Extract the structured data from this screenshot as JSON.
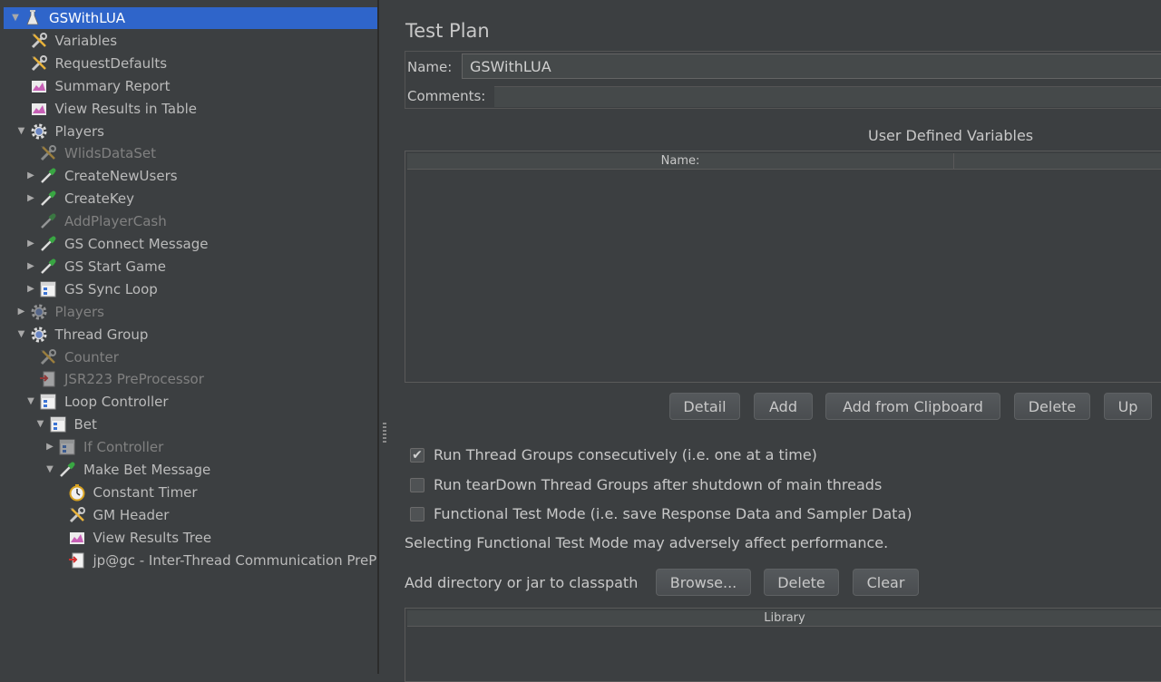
{
  "tree": {
    "items": [
      {
        "label": "GSWithLUA",
        "icon": "test-plan-icon",
        "arrow": "▼",
        "selected": true
      },
      {
        "label": "Variables",
        "icon": "wrench-icon"
      },
      {
        "label": "RequestDefaults",
        "icon": "wrench-icon"
      },
      {
        "label": "Summary Report",
        "icon": "report-icon"
      },
      {
        "label": "View Results in Table",
        "icon": "report-icon"
      },
      {
        "label": "Players",
        "icon": "gear-icon",
        "arrow": "▼"
      },
      {
        "label": "WlidsDataSet",
        "icon": "wrench-icon",
        "disabled": true
      },
      {
        "label": "CreateNewUsers",
        "icon": "pipette-icon",
        "arrow": "▶"
      },
      {
        "label": "CreateKey",
        "icon": "pipette-icon",
        "arrow": "▶"
      },
      {
        "label": "AddPlayerCash",
        "icon": "pipette-icon",
        "disabled": true
      },
      {
        "label": "GS Connect Message",
        "icon": "pipette-icon",
        "arrow": "▶"
      },
      {
        "label": "GS Start Game",
        "icon": "pipette-icon",
        "arrow": "▶"
      },
      {
        "label": "GS Sync Loop",
        "icon": "controller-icon",
        "arrow": "▶"
      },
      {
        "label": "Players",
        "icon": "gear-icon",
        "arrow": "▶",
        "disabled": true
      },
      {
        "label": "Thread Group",
        "icon": "gear-icon",
        "arrow": "▼"
      },
      {
        "label": "Counter",
        "icon": "wrench-icon",
        "disabled": true
      },
      {
        "label": "JSR223 PreProcessor",
        "icon": "preprocessor-icon",
        "disabled": true
      },
      {
        "label": "Loop Controller",
        "icon": "controller-icon",
        "arrow": "▼"
      },
      {
        "label": "Bet",
        "icon": "controller-icon",
        "arrow": "▼"
      },
      {
        "label": "If Controller",
        "icon": "controller-icon",
        "arrow": "▶",
        "disabled": true
      },
      {
        "label": "Make Bet Message",
        "icon": "pipette-icon",
        "arrow": "▼"
      },
      {
        "label": "Constant Timer",
        "icon": "timer-icon"
      },
      {
        "label": "GM Header",
        "icon": "wrench-icon"
      },
      {
        "label": "View Results Tree",
        "icon": "report-icon"
      },
      {
        "label": "jp@gc - Inter-Thread Communication PreProcessor",
        "icon": "preprocessor-icon"
      }
    ]
  },
  "panel": {
    "title": "Test Plan",
    "name_label": "Name:",
    "name_value": "GSWithLUA",
    "comments_label": "Comments:",
    "udv_title": "User Defined Variables",
    "udv_col_name": "Name:",
    "buttons": {
      "detail": "Detail",
      "add": "Add",
      "add_clipboard": "Add from Clipboard",
      "delete": "Delete",
      "up": "Up"
    },
    "checkboxes": [
      {
        "label": "Run Thread Groups consecutively (i.e. one at a time)",
        "checked": true
      },
      {
        "label": "Run tearDown Thread Groups after shutdown of main threads",
        "checked": false
      },
      {
        "label": "Functional Test Mode (i.e. save Response Data and Sampler Data)",
        "checked": false
      }
    ],
    "warning": "Selecting Functional Test Mode may adversely affect performance.",
    "classpath_label": "Add directory or jar to classpath",
    "cp_buttons": {
      "browse": "Browse...",
      "delete": "Delete",
      "clear": "Clear"
    },
    "library_header": "Library"
  },
  "colors": {
    "selection": "#2f65ca",
    "background": "#3c3f41"
  }
}
